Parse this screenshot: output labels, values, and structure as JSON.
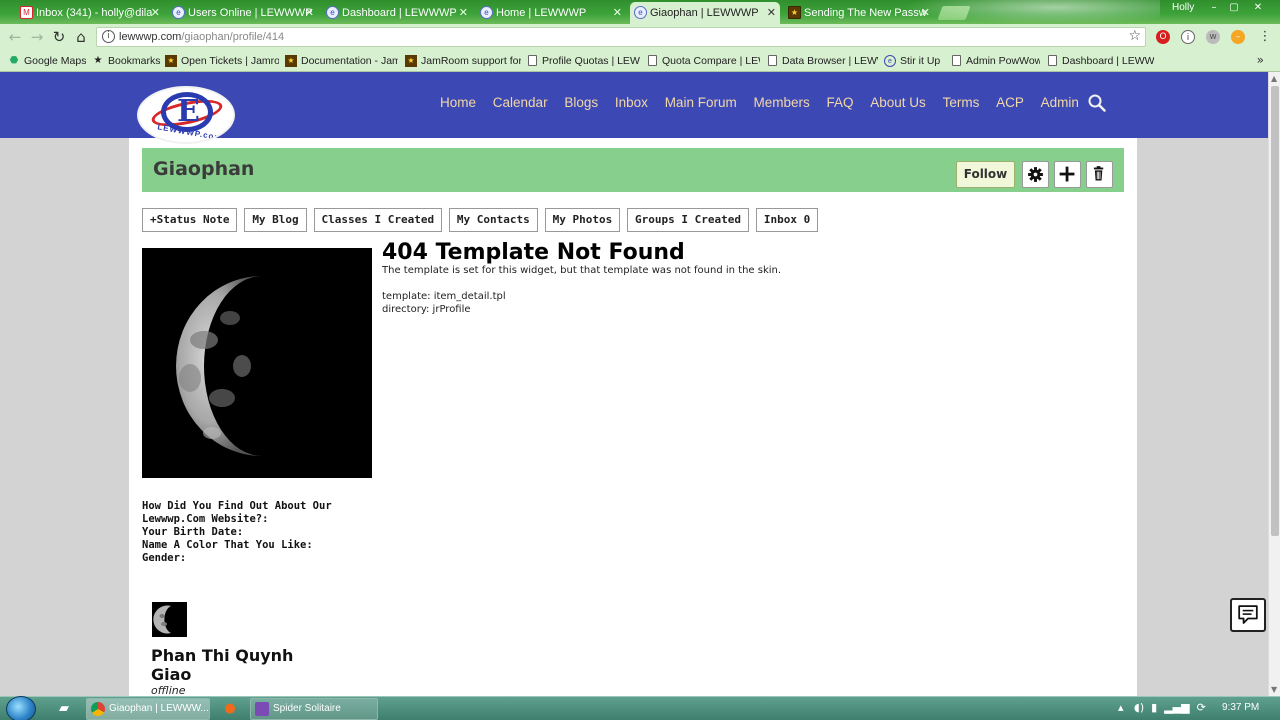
{
  "browser": {
    "tabs": [
      {
        "title": "Inbox (341) - holly@dila",
        "icon": "gmail-icon"
      },
      {
        "title": "Users Online | LEWWWP",
        "icon": "lewwwp-icon"
      },
      {
        "title": "Dashboard | LEWWWP",
        "icon": "lewwwp-icon"
      },
      {
        "title": "Home | LEWWWP",
        "icon": "lewwwp-icon"
      },
      {
        "title": "Giaophan | LEWWWP",
        "icon": "lewwwp-icon",
        "active": true
      },
      {
        "title": "Sending The New Passw",
        "icon": "jamroom-icon"
      }
    ],
    "tab_close": "✕",
    "user": "Holly",
    "window_controls": {
      "minimize": "–",
      "maximize": "▢",
      "close": "✕"
    },
    "url_host": "lewwwp.com",
    "url_path": "/giaophan/profile/414",
    "bookmarks": [
      {
        "label": "Google Maps",
        "icon": "maps-icon"
      },
      {
        "label": "Bookmarks",
        "icon": "star-icon"
      },
      {
        "label": "Open Tickets | Jamroo",
        "icon": "jamroom-icon"
      },
      {
        "label": "Documentation - Jam",
        "icon": "jamroom-icon"
      },
      {
        "label": "JamRoom support for",
        "icon": "jamroom-icon"
      },
      {
        "label": "Profile Quotas | LEW",
        "icon": "page-icon"
      },
      {
        "label": "Quota Compare | LEW",
        "icon": "page-icon"
      },
      {
        "label": "Data Browser | LEWW",
        "icon": "page-icon"
      },
      {
        "label": "Stir it Up",
        "icon": "lewwwp-icon"
      },
      {
        "label": "Admin PowWow",
        "icon": "page-icon"
      },
      {
        "label": "Dashboard | LEWWW",
        "icon": "page-icon"
      }
    ],
    "bookmarks_more": "»"
  },
  "site": {
    "logo_text": "LEWWWP.com",
    "logo_letter": "E",
    "nav": [
      "Home",
      "Calendar",
      "Blogs",
      "Inbox",
      "Main Forum",
      "Members",
      "FAQ",
      "About Us",
      "Terms",
      "ACP",
      "Admin"
    ],
    "colors": {
      "header": "#3c49b4",
      "nav_text": "#f2d7a8",
      "profile_bar": "#86cf8c"
    }
  },
  "profile": {
    "name": "Giaophan",
    "follow_label": "Follow",
    "tab_buttons": [
      "+Status Note",
      "My Blog",
      "Classes I Created",
      "My Contacts",
      "My Photos",
      "Groups I Created",
      "Inbox 0"
    ],
    "questions": [
      "How Did You Find Out About Our Lewwwp.Com Website?:",
      "Your Birth Date:",
      "Name A Color That You Like:",
      "Gender:"
    ],
    "full_name": "Phan Thi Quynh Giao",
    "status": "offline"
  },
  "error": {
    "title": "404 Template Not Found",
    "message": "The template is set for this widget, but that template was not found in the skin.",
    "template_line": "template: item_detail.tpl",
    "directory_line": "directory: jrProfile"
  },
  "taskbar": {
    "items": [
      {
        "label": "Giaophan | LEWWW...",
        "icon": "chrome-icon",
        "active": true
      },
      {
        "label": "Spider Solitaire",
        "icon": "solitaire-icon"
      }
    ],
    "clock": "9:37 PM"
  }
}
